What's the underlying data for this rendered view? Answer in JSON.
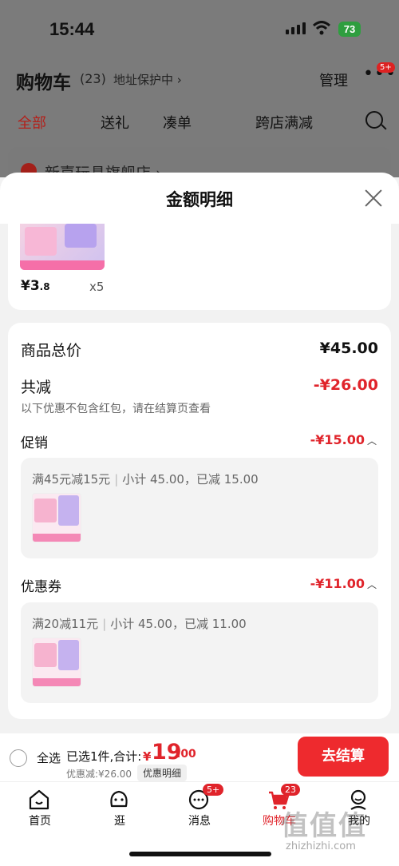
{
  "status": {
    "time": "15:44",
    "battery": "73"
  },
  "background_page": {
    "title": "购物车",
    "count": "(23)",
    "address": "地址保护中 ›",
    "manage": "管理",
    "more": "•••",
    "more_badge": "5+",
    "tabs": [
      "全部",
      "送礼",
      "凑单",
      "跨店满减",
      "[fragment]"
    ],
    "store_name": "新嘉玩具旗舰店 ›"
  },
  "sheet": {
    "title": "金额明细",
    "item": {
      "price_int": "¥3",
      "price_dec": ".8",
      "quantity": "x5"
    },
    "total_label": "商品总价",
    "total_value": "¥45.00",
    "reduce_label": "共减",
    "reduce_value": "-¥26.00",
    "note": "以下优惠不包含红包，请在结算页查看",
    "promo": {
      "label": "促销",
      "value": "-¥15.00",
      "rule": "满45元减15元",
      "subtotal": "小计 45.00，已减 15.00"
    },
    "coupon": {
      "label": "优惠券",
      "value": "-¥11.00",
      "rule": "满20减11元",
      "subtotal": "小计 45.00，已减 11.00"
    }
  },
  "checkout": {
    "select_all": "全选",
    "selected": "已选1件,合计:",
    "currency": "¥",
    "total_int": "19",
    "total_dec": ".00",
    "discount": "优惠减:¥26.00",
    "detail_button": "优惠明细",
    "pay_button": "去结算"
  },
  "tabbar": [
    {
      "label": "首页",
      "icon": "home-icon"
    },
    {
      "label": "逛",
      "icon": "face-icon"
    },
    {
      "label": "消息",
      "icon": "message-icon",
      "badge": "5+"
    },
    {
      "label": "购物车",
      "icon": "cart-icon",
      "badge": "23"
    },
    {
      "label": "我的",
      "icon": "profile-icon"
    }
  ],
  "watermark": {
    "text": "值值值",
    "url": "zhizhizhi.com"
  },
  "colors": {
    "accent": "#e0242b",
    "pay_button": "#ee2a2e"
  }
}
